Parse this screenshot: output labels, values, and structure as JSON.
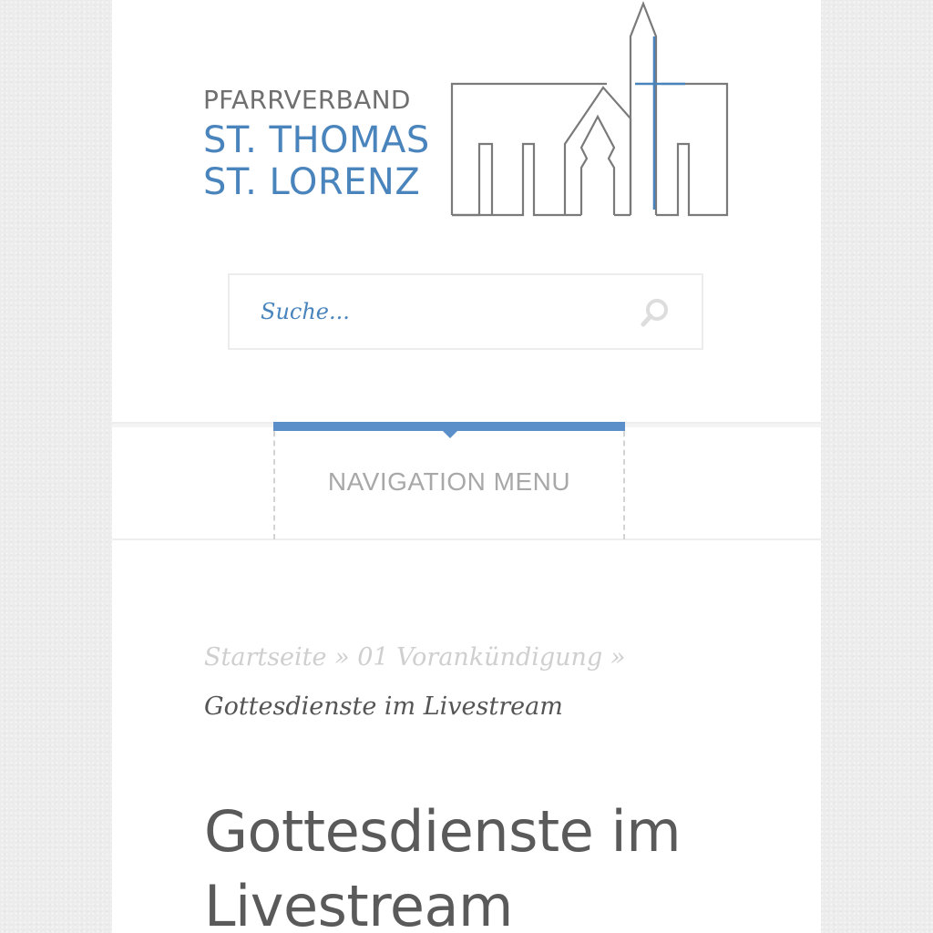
{
  "header": {
    "logo": {
      "line1": "PFARRVERBAND",
      "line2": "ST. THOMAS",
      "line3": "ST. LORENZ",
      "icon": "church-icon"
    }
  },
  "search": {
    "placeholder": "Suche...",
    "value": "",
    "icon": "search-icon"
  },
  "nav": {
    "menu_label": "NAVIGATION MENU"
  },
  "breadcrumb": {
    "items": [
      {
        "label": "Startseite"
      },
      {
        "label": "01 Vorankündigung"
      }
    ],
    "separator": "»",
    "current": "Gottesdienste im Livestream"
  },
  "main": {
    "title": "Gottesdienste im Livestream"
  },
  "colors": {
    "accent": "#4a84bd",
    "nav_bar": "#5a8fca",
    "text_gray": "#5a5a5a",
    "muted": "#cfcfcf",
    "background": "#ececec"
  }
}
